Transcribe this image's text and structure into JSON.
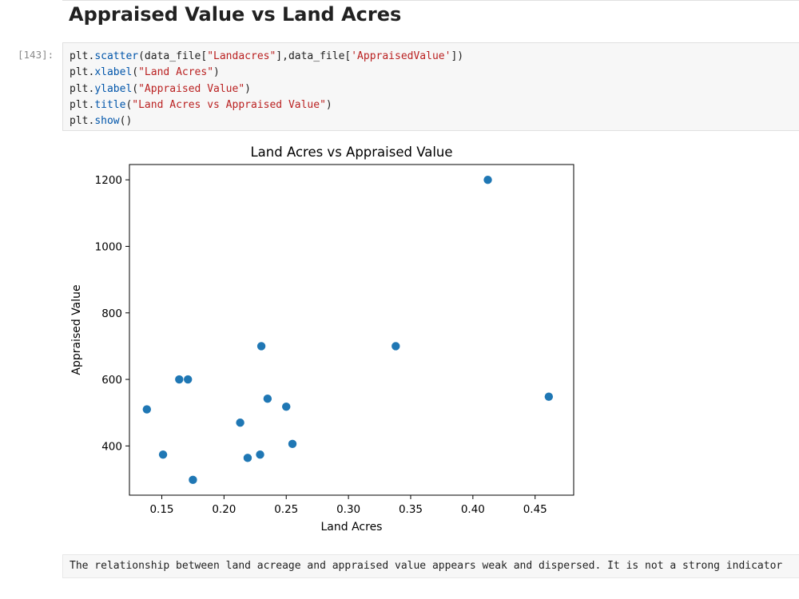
{
  "heading": "Appraised Value vs Land Acres",
  "cell": {
    "prompt": "[143]:",
    "code": [
      [
        {
          "t": "plt",
          "k": "var"
        },
        {
          "t": ".",
          "k": "var"
        },
        {
          "t": "scatter",
          "k": "fn"
        },
        {
          "t": "(data_file[",
          "k": "var"
        },
        {
          "t": "\"Landacres\"",
          "k": "str"
        },
        {
          "t": "],data_file[",
          "k": "var"
        },
        {
          "t": "'AppraisedValue'",
          "k": "str"
        },
        {
          "t": "])",
          "k": "var"
        }
      ],
      [
        {
          "t": "plt",
          "k": "var"
        },
        {
          "t": ".",
          "k": "var"
        },
        {
          "t": "xlabel",
          "k": "fn"
        },
        {
          "t": "(",
          "k": "var"
        },
        {
          "t": "\"Land Acres\"",
          "k": "str"
        },
        {
          "t": ")",
          "k": "var"
        }
      ],
      [
        {
          "t": "plt",
          "k": "var"
        },
        {
          "t": ".",
          "k": "var"
        },
        {
          "t": "ylabel",
          "k": "fn"
        },
        {
          "t": "(",
          "k": "var"
        },
        {
          "t": "\"Appraised Value\"",
          "k": "str"
        },
        {
          "t": ")",
          "k": "var"
        }
      ],
      [
        {
          "t": "plt",
          "k": "var"
        },
        {
          "t": ".",
          "k": "var"
        },
        {
          "t": "title",
          "k": "fn"
        },
        {
          "t": "(",
          "k": "var"
        },
        {
          "t": "\"Land Acres vs Appraised Value\"",
          "k": "str"
        },
        {
          "t": ")",
          "k": "var"
        }
      ],
      [
        {
          "t": "plt",
          "k": "var"
        },
        {
          "t": ".",
          "k": "var"
        },
        {
          "t": "show",
          "k": "fn"
        },
        {
          "t": "()",
          "k": "var"
        }
      ]
    ]
  },
  "chart_data": {
    "type": "scatter",
    "title": "Land Acres vs Appraised Value",
    "xlabel": "Land Acres",
    "ylabel": "Appraised Value",
    "xlim": [
      0.124,
      0.481
    ],
    "ylim": [
      252,
      1246
    ],
    "xticks": [
      0.15,
      0.2,
      0.25,
      0.3,
      0.35,
      0.4,
      0.45
    ],
    "xtick_labels": [
      "0.15",
      "0.20",
      "0.25",
      "0.30",
      "0.35",
      "0.40",
      "0.45"
    ],
    "yticks": [
      400,
      600,
      800,
      1000,
      1200
    ],
    "ytick_labels": [
      "400",
      "600",
      "800",
      "1000",
      "1200"
    ],
    "grid": false,
    "color": "#1f77b4",
    "points": [
      {
        "x": 0.138,
        "y": 510
      },
      {
        "x": 0.151,
        "y": 374
      },
      {
        "x": 0.164,
        "y": 600
      },
      {
        "x": 0.171,
        "y": 600
      },
      {
        "x": 0.175,
        "y": 298
      },
      {
        "x": 0.213,
        "y": 470
      },
      {
        "x": 0.219,
        "y": 364
      },
      {
        "x": 0.229,
        "y": 374
      },
      {
        "x": 0.23,
        "y": 700
      },
      {
        "x": 0.235,
        "y": 542
      },
      {
        "x": 0.25,
        "y": 518
      },
      {
        "x": 0.255,
        "y": 406
      },
      {
        "x": 0.338,
        "y": 700
      },
      {
        "x": 0.412,
        "y": 1200
      },
      {
        "x": 0.461,
        "y": 548
      }
    ]
  },
  "markdown": {
    "text": "The relationship between land acreage and appraised value appears weak and dispersed. It is not a strong indicator"
  }
}
